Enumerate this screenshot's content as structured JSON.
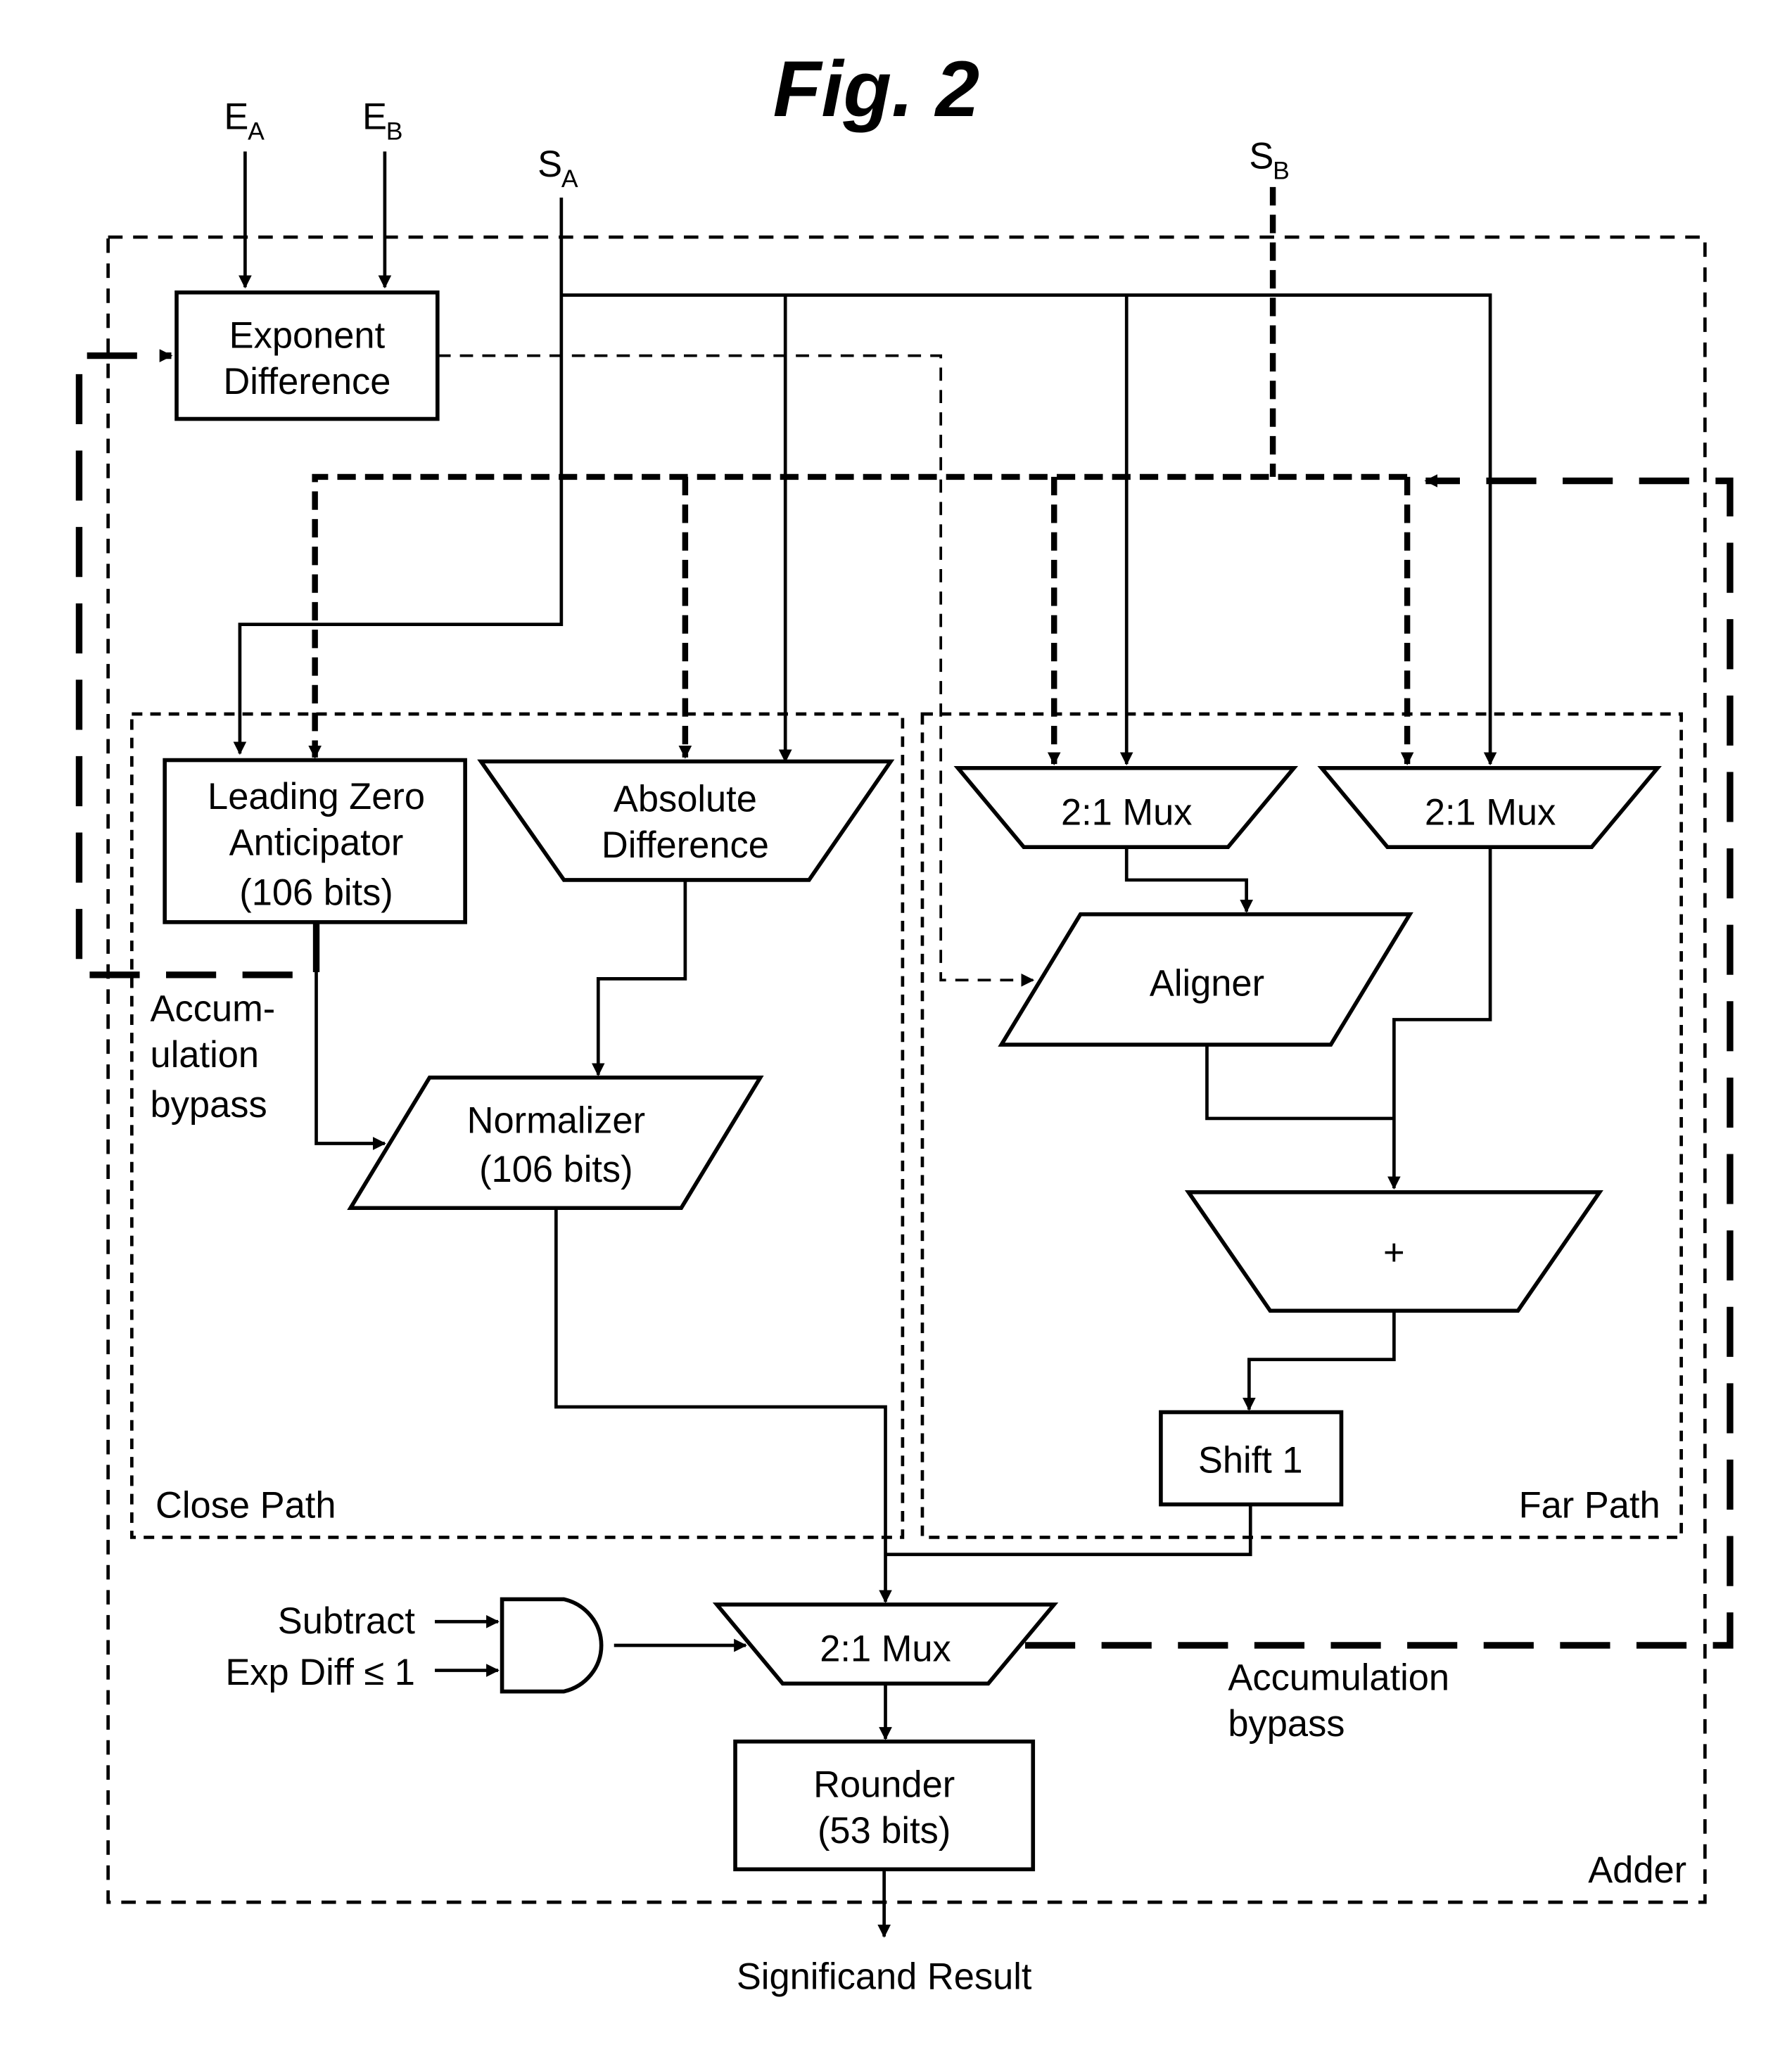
{
  "figure": {
    "title": "Fig. 2",
    "inputs": {
      "ea": {
        "main": "E",
        "sub": "A"
      },
      "eb": {
        "main": "E",
        "sub": "B"
      },
      "sa": {
        "main": "S",
        "sub": "A"
      },
      "sb": {
        "main": "S",
        "sub": "B"
      }
    },
    "blocks": {
      "exponent_difference": [
        "Exponent",
        "Difference"
      ],
      "lza": [
        "Leading Zero",
        "Anticipator",
        "(106 bits)"
      ],
      "absolute_difference": [
        "Absolute",
        "Difference"
      ],
      "normalizer": [
        "Normalizer",
        "(106 bits)"
      ],
      "mux_far_left": "2:1 Mux",
      "mux_far_right": "2:1 Mux",
      "aligner": "Aligner",
      "adder_op": "+",
      "shift1": "Shift 1",
      "mux_final": "2:1 Mux",
      "rounder": [
        "Rounder",
        "(53 bits)"
      ]
    },
    "gate_inputs": [
      "Subtract",
      "Exp Diff ≤ 1"
    ],
    "regions": {
      "close_path": "Close Path",
      "far_path": "Far Path",
      "adder": "Adder"
    },
    "annotations": {
      "accum_bypass_left": [
        "Accum-",
        "ulation",
        "bypass"
      ],
      "accum_bypass_right": [
        "Accumulation",
        "bypass"
      ]
    },
    "output": "Significand Result"
  }
}
